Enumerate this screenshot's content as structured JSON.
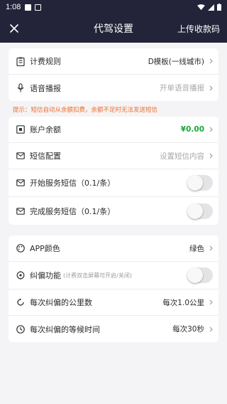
{
  "status_bar": {
    "time": "1:08"
  },
  "appbar": {
    "title": "代驾设置",
    "action_label": "上传收款码"
  },
  "section1": [
    {
      "label": "计费规则",
      "value": "D模板(一线城市)"
    },
    {
      "label": "语音播报",
      "value": "开单语音播报"
    }
  ],
  "tip": "提示：短信自动从余额扣费，余额不足时无法发送短信",
  "section2": {
    "balance": {
      "label": "账户余额",
      "value": "¥0.00"
    },
    "sms_config": {
      "label": "短信配置",
      "value": "设置短信内容"
    },
    "start_sms": {
      "label": "开始服务短信（0.1/条）",
      "on": false
    },
    "finish_sms": {
      "label": "完成服务短信（0.1/条）",
      "on": false
    }
  },
  "section3": {
    "app_color": {
      "label": "APP颜色",
      "value": "绿色"
    },
    "correction": {
      "label": "纠偏功能",
      "note": "(计费双击屏幕可开启/关闭)",
      "on": false
    },
    "km_per": {
      "label": "每次纠偏的公里数",
      "value": "每次1.0公里"
    },
    "wait_time": {
      "label": "每次纠偏的等候时间",
      "value": "每次30秒"
    }
  },
  "colors": {
    "header_bg": "#23233a",
    "balance_green": "#1aaa3a",
    "tip_orange": "#ee6e2a"
  }
}
